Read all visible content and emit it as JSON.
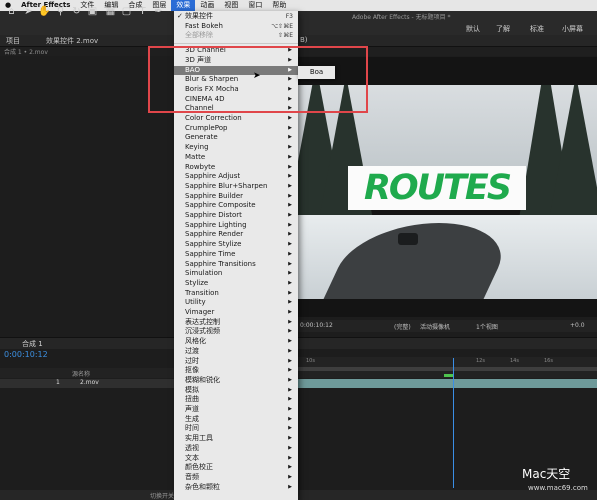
{
  "menubar": {
    "apple": "",
    "items": [
      "After Effects",
      "文件",
      "编辑",
      "合成",
      "图层",
      "效果",
      "动画",
      "视图",
      "窗口",
      "帮助"
    ],
    "active_index": 5
  },
  "window_title": "Adobe After Effects - 无标题项目 *",
  "workspace": {
    "items": [
      "默认",
      "了解",
      "标准",
      "小屏幕"
    ]
  },
  "panels": {
    "project": "项目",
    "effects_controls": "效果控件 2.mov",
    "comp_path": "合成 1 • 2.mov",
    "comp_path_right": "B)"
  },
  "viewer": {
    "title_card": "ROUTES",
    "timecode": "0:00:10:12",
    "quality": "(完整)",
    "camera": "活动摄像机",
    "views": "1个视图",
    "exposure": "+0.0"
  },
  "timeline": {
    "tab": "合成 1",
    "timecode": "0:00:10:12",
    "col_source": "源名称",
    "layer_num": "1",
    "layer_name": "2.mov",
    "ruler_labels": [
      "10s",
      "12s",
      "14s",
      "16s"
    ],
    "bottom_label": "切换开关/模式"
  },
  "effect_menu": {
    "items": [
      {
        "label": "效果控件",
        "shortcut": "F3",
        "checked": true,
        "type": "item"
      },
      {
        "label": "Fast Bokeh",
        "shortcut": "⌥⇧⌘E",
        "type": "item"
      },
      {
        "label": "全部移除",
        "shortcut": "⇧⌘E",
        "type": "disabled"
      },
      {
        "type": "sep"
      },
      {
        "label": "3D Channel",
        "type": "sub"
      },
      {
        "label": "3D 声道",
        "type": "sub"
      },
      {
        "label": "BAO",
        "type": "sub",
        "highlight": true
      },
      {
        "label": "Blur & Sharpen",
        "type": "sub"
      },
      {
        "label": "Boris FX Mocha",
        "type": "sub"
      },
      {
        "label": "CINEMA 4D",
        "type": "sub"
      },
      {
        "label": "Channel",
        "type": "sub"
      },
      {
        "label": "Color Correction",
        "type": "sub"
      },
      {
        "label": "CrumplePop",
        "type": "sub"
      },
      {
        "label": "Generate",
        "type": "sub"
      },
      {
        "label": "Keying",
        "type": "sub"
      },
      {
        "label": "Matte",
        "type": "sub"
      },
      {
        "label": "Rowbyte",
        "type": "sub"
      },
      {
        "label": "Sapphire Adjust",
        "type": "sub"
      },
      {
        "label": "Sapphire Blur+Sharpen",
        "type": "sub"
      },
      {
        "label": "Sapphire Builder",
        "type": "sub"
      },
      {
        "label": "Sapphire Composite",
        "type": "sub"
      },
      {
        "label": "Sapphire Distort",
        "type": "sub"
      },
      {
        "label": "Sapphire Lighting",
        "type": "sub"
      },
      {
        "label": "Sapphire Render",
        "type": "sub"
      },
      {
        "label": "Sapphire Stylize",
        "type": "sub"
      },
      {
        "label": "Sapphire Time",
        "type": "sub"
      },
      {
        "label": "Sapphire Transitions",
        "type": "sub"
      },
      {
        "label": "Simulation",
        "type": "sub"
      },
      {
        "label": "Stylize",
        "type": "sub"
      },
      {
        "label": "Transition",
        "type": "sub"
      },
      {
        "label": "Utility",
        "type": "sub"
      },
      {
        "label": "Vimager",
        "type": "sub"
      },
      {
        "label": "表达式控制",
        "type": "sub"
      },
      {
        "label": "沉浸式视频",
        "type": "sub"
      },
      {
        "label": "风格化",
        "type": "sub"
      },
      {
        "label": "过渡",
        "type": "sub"
      },
      {
        "label": "过时",
        "type": "sub"
      },
      {
        "label": "抠像",
        "type": "sub"
      },
      {
        "label": "模糊和锐化",
        "type": "sub"
      },
      {
        "label": "模拟",
        "type": "sub"
      },
      {
        "label": "扭曲",
        "type": "sub"
      },
      {
        "label": "声道",
        "type": "sub"
      },
      {
        "label": "生成",
        "type": "sub"
      },
      {
        "label": "时间",
        "type": "sub"
      },
      {
        "label": "实用工具",
        "type": "sub"
      },
      {
        "label": "透视",
        "type": "sub"
      },
      {
        "label": "文本",
        "type": "sub"
      },
      {
        "label": "颜色校正",
        "type": "sub"
      },
      {
        "label": "音频",
        "type": "sub"
      },
      {
        "label": "杂色和颗粒",
        "type": "sub"
      }
    ]
  },
  "submenu": {
    "label": "Boa"
  },
  "watermark": {
    "brand": "Mac天空",
    "url": "www.mac69.com"
  },
  "colors": {
    "accent": "#2a6cd6",
    "highlight": "#e0464a",
    "title_green": "#1faa4d"
  }
}
